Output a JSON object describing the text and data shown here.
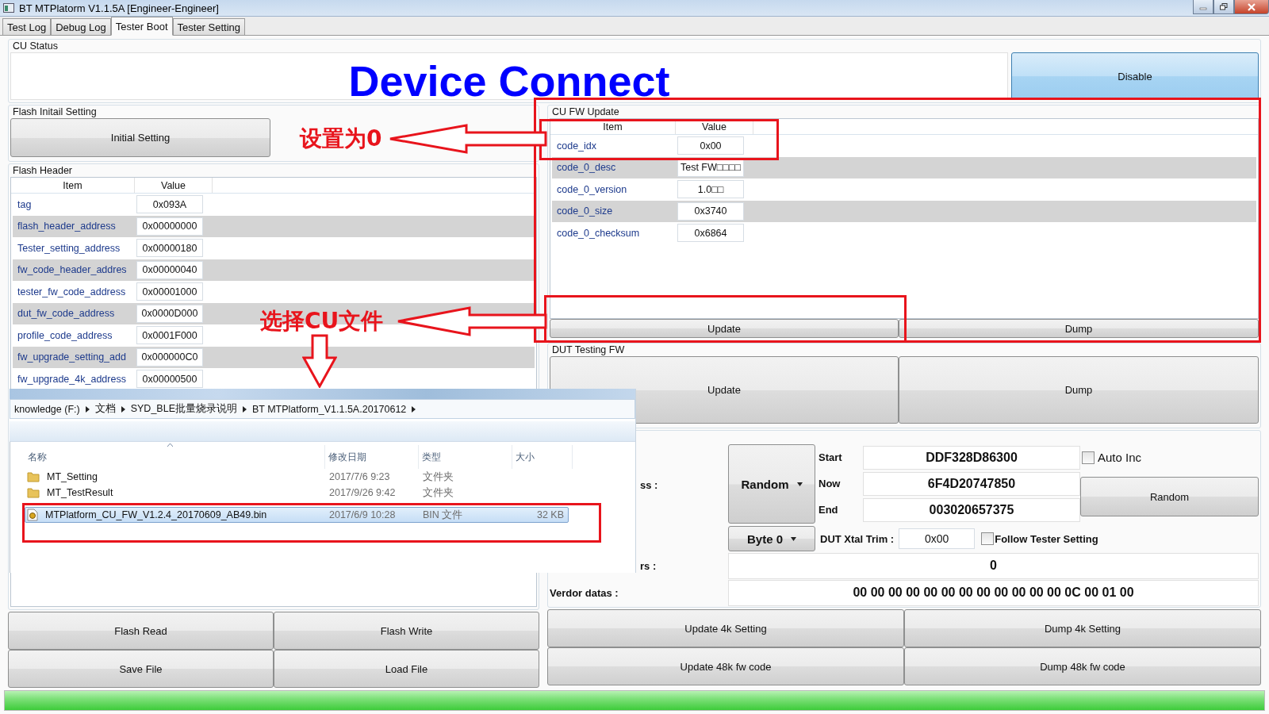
{
  "window": {
    "title": "BT MTPlatorm V1.1.5A [Engineer-Engineer]"
  },
  "tabs": [
    {
      "label": "Test Log",
      "selected": false
    },
    {
      "label": "Debug Log",
      "selected": false
    },
    {
      "label": "Tester Boot",
      "selected": true
    },
    {
      "label": "Tester Setting",
      "selected": false
    }
  ],
  "cu_status": {
    "title": "CU Status",
    "message": "Device Connect",
    "button": "Disable"
  },
  "flash_initial_setting": {
    "title": "Flash Initail Setting",
    "button": "Initial Setting"
  },
  "flash_header": {
    "title": "Flash Header",
    "columns": [
      "Item",
      "Value"
    ],
    "rows": [
      {
        "item": "tag",
        "value": "0x093A"
      },
      {
        "item": "flash_header_address",
        "value": "0x00000000"
      },
      {
        "item": "Tester_setting_address",
        "value": "0x00000180"
      },
      {
        "item": "fw_code_header_addres",
        "value": "0x00000040"
      },
      {
        "item": "tester_fw_code_address",
        "value": "0x00001000"
      },
      {
        "item": "dut_fw_code_address",
        "value": "0x0000D000"
      },
      {
        "item": "profile_code_address",
        "value": "0x0001F000"
      },
      {
        "item": "fw_upgrade_setting_add",
        "value": "0x000000C0"
      },
      {
        "item": "fw_upgrade_4k_address",
        "value": "0x00000500"
      }
    ]
  },
  "flash_buttons": [
    "Flash Read",
    "Flash Write",
    "Save File",
    "Load File"
  ],
  "cu_fw_update": {
    "title": "CU FW Update",
    "columns": [
      "Item",
      "Value"
    ],
    "rows": [
      {
        "item": "code_idx",
        "value": "0x00"
      },
      {
        "item": "code_0_desc",
        "value": "Test FW□□□□"
      },
      {
        "item": "code_0_version",
        "value": "1.0□□"
      },
      {
        "item": "code_0_size",
        "value": "0x3740"
      },
      {
        "item": "code_0_checksum",
        "value": "0x6864"
      }
    ],
    "buttons": [
      "Update",
      "Dump"
    ]
  },
  "dut_testing_fw": {
    "title": "DUT Testing FW",
    "buttons": [
      "Update",
      "Dump"
    ]
  },
  "address": {
    "label": "ss :",
    "mode": "Random",
    "start_label": "Start",
    "start": "DDF328D86300",
    "now_label": "Now",
    "now": "6F4D20747850",
    "end_label": "End",
    "end": "003020657375",
    "auto_inc": {
      "label": "Auto Inc",
      "checked": false
    },
    "random_button": "Random",
    "byte": "Byte 0",
    "xtal_label": "DUT Xtal Trim :",
    "xtal": "0x00",
    "follow": {
      "label": "Follow Tester Setting",
      "checked": false
    },
    "count_label": "rs :",
    "count": "0",
    "vendor_label": "Verdor datas :",
    "vendor": "00 00 00 00 00 00 00 00 00 00 00 00 0C 00 01 00"
  },
  "setting_buttons": [
    "Update 4k Setting",
    "Dump 4k Setting",
    "Update 48k fw code",
    "Dump 48k fw code"
  ],
  "progress": {
    "level": 1
  },
  "file_browser": {
    "path": [
      "knowledge (F:)",
      "文档",
      "SYD_BLE批量烧录说明",
      "BT MTPlatform_V1.1.5A.20170612"
    ],
    "columns": [
      "名称",
      "修改日期",
      "类型",
      "大小"
    ],
    "files": [
      {
        "kind": "folder",
        "name": "MT_Setting",
        "modified": "2017/7/6 9:23",
        "type": "文件夹",
        "selected": false
      },
      {
        "kind": "folder",
        "name": "MT_TestResult",
        "modified": "2017/9/26 9:42",
        "type": "文件夹",
        "selected": false
      },
      {
        "kind": "file",
        "name": "MTPlatform_CU_FW_V1.2.4_20170609_AB49.bin",
        "modified": "2017/6/9 10:28",
        "type": "BIN 文件",
        "size": "32 KB",
        "selected": true
      }
    ]
  },
  "annotations": [
    {
      "text": "设置为0"
    },
    {
      "text": "选择CU文件"
    }
  ]
}
